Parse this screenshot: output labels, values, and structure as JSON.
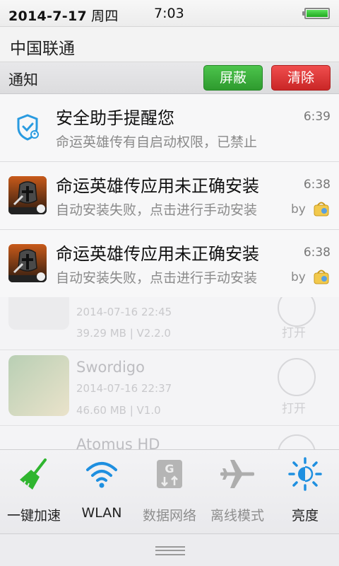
{
  "status_bar": {
    "date": "2014-7-17",
    "weekday": "周四",
    "time": "7:03",
    "battery_level": 1.0,
    "battery_color": "#2fbf2f"
  },
  "carrier": "中国联通",
  "notifications_header": {
    "title": "通知",
    "block_label": "屏蔽",
    "clear_label": "清除",
    "block_color": "#36a836",
    "clear_color": "#db3535"
  },
  "notifications": [
    {
      "icon": "security-shield-icon",
      "title": "安全助手提醒您",
      "subtitle": "命运英雄传有自启动权限，已禁止",
      "time": "6:39"
    },
    {
      "icon": "knight-game-icon",
      "title": "命运英雄传应用未正确安装",
      "subtitle": "自动安装失败，点击进行手动安装",
      "time": "6:38",
      "by": "by",
      "by_icon": "app-manager-bag-icon"
    },
    {
      "icon": "knight-game-icon",
      "title": "命运英雄传应用未正确安装",
      "subtitle": "自动安装失败，点击进行手动安装",
      "time": "6:38",
      "by": "by",
      "by_icon": "app-manager-bag-icon"
    }
  ],
  "background_apps": [
    {
      "name": "",
      "date": "2014-07-16 22:45",
      "size": "39.29 MB",
      "version": "V2.2.0",
      "action": "打开"
    },
    {
      "name": "Swordigo",
      "date": "2014-07-16 22:37",
      "size": "46.60 MB",
      "version": "V1.0",
      "action": "打开"
    },
    {
      "name": "Atomus HD"
    }
  ],
  "quick_toggles": [
    {
      "label": "一键加速",
      "icon": "broom-icon",
      "active": true,
      "color": "#2fb52f"
    },
    {
      "label": "WLAN",
      "icon": "wifi-icon",
      "active": true,
      "color": "#1e8fe0"
    },
    {
      "label": "数据网络",
      "icon": "mobile-data-icon",
      "active": false,
      "color": "#a8a8a8"
    },
    {
      "label": "离线模式",
      "icon": "airplane-icon",
      "active": false,
      "color": "#a8a8a8"
    },
    {
      "label": "亮度",
      "icon": "brightness-icon",
      "active": true,
      "color": "#1e8fe0"
    }
  ]
}
